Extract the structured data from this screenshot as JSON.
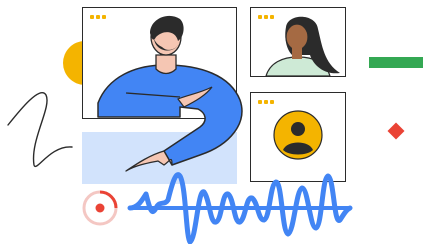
{
  "illustration": {
    "colors": {
      "outline": "#2b2b2b",
      "blue": "#4285f4",
      "light_blue": "#d2e3fc",
      "yellow": "#f4b400",
      "green": "#34a853",
      "red": "#ea4335",
      "skin_light": "#f5c6b3",
      "skin_dark": "#a56a43",
      "hair": "#2b2b2b",
      "shirt_mint": "#ceead6"
    },
    "icons": [
      "presenter-avatar",
      "participant-avatar",
      "placeholder-user-icon",
      "window-dots",
      "record-icon",
      "audio-waveform",
      "scribble",
      "green-dash",
      "red-diamond",
      "yellow-circle"
    ]
  }
}
